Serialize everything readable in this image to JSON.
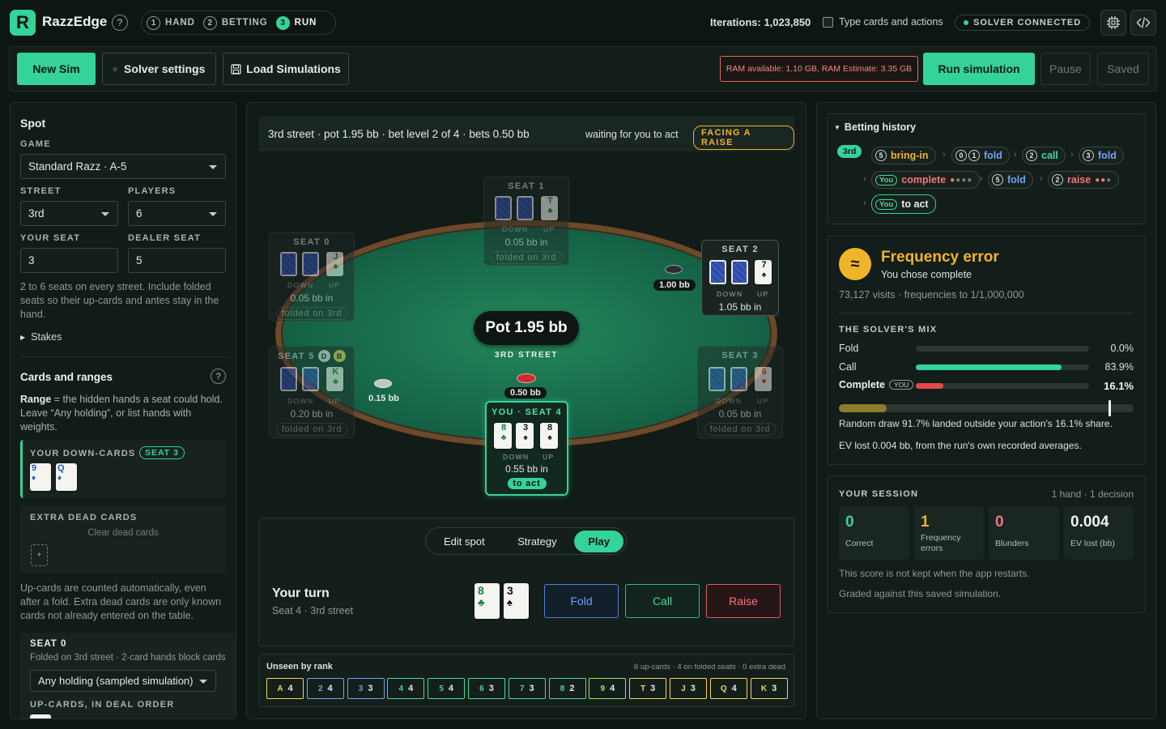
{
  "app": {
    "name": "RazzEdge",
    "help": "?"
  },
  "steps": [
    {
      "n": "1",
      "label": "HAND"
    },
    {
      "n": "2",
      "label": "BETTING"
    },
    {
      "n": "3",
      "label": "RUN"
    }
  ],
  "header": {
    "iterations": "Iterations: 1,023,850",
    "type_cards_label": "Type cards and actions",
    "solver_status": "SOLVER CONNECTED"
  },
  "toolbar": {
    "new_sim": "New Sim",
    "solver_settings": "Solver settings",
    "load_simulations": "Load Simulations",
    "ram_warning": "RAM available: 1.10 GB, RAM Estimate: 3.35 GB",
    "run_simulation": "Run simulation",
    "pause": "Pause",
    "saved": "Saved"
  },
  "left": {
    "spot_title": "Spot",
    "game_label": "GAME",
    "game_value": "Standard Razz · A-5",
    "street_label": "STREET",
    "street_value": "3rd",
    "players_label": "PLAYERS",
    "players_value": "6",
    "your_seat_label": "YOUR SEAT",
    "your_seat_value": "3",
    "dealer_seat_label": "DEALER SEAT",
    "dealer_seat_value": "5",
    "seats_help": "2 to 6 seats on every street. Include folded seats so their up-cards and antes stay in the hand.",
    "stakes": "Stakes",
    "cards_title": "Cards and ranges",
    "cards_help": "?",
    "range_word": "Range",
    "range_help": " = the hidden hands a seat could hold. Leave “Any holding”, or list hands with weights.",
    "your_down_cards": "YOUR DOWN-CARDS",
    "seat_tag": "SEAT 3",
    "down_cards": [
      {
        "rank": "9",
        "suit": "♦"
      },
      {
        "rank": "Q",
        "suit": "♦"
      }
    ],
    "extra_dead": "EXTRA DEAD CARDS",
    "clear_dead": "Clear dead cards",
    "add": "+",
    "upcards_help": "Up-cards are counted automatically, even after a fold. Extra dead cards are only known cards not already entered on the table.",
    "seat0_title": "SEAT 0",
    "seat0_sub": "Folded on 3rd street · 2-card hands block cards",
    "seat0_holding": "Any holding (sampled simulation)",
    "upcards_order": "UP-CARDS, IN DEAL ORDER"
  },
  "center": {
    "street_info": "3rd street · pot 1.95 bb · bet level 2 of 4 · bets 0.50 bb",
    "waiting": "waiting for you to act",
    "facing": "FACING A RAISE",
    "pot": "Pot 1.95 bb",
    "street_name": "3RD STREET",
    "down": "DOWN",
    "up": "UP",
    "seats": [
      {
        "name": "SEAT 0",
        "upcard": {
          "rank": "J",
          "suit": "♣"
        },
        "in": "0.05 bb in",
        "status": "folded on 3rd"
      },
      {
        "name": "SEAT 1",
        "upcard": {
          "rank": "T",
          "suit": "♣"
        },
        "in": "0.05 bb in",
        "status": "folded on 3rd"
      },
      {
        "name": "SEAT 2",
        "upcard": {
          "rank": "7",
          "suit": "♠"
        },
        "in": "1.05 bb in",
        "status": ""
      },
      {
        "name": "SEAT 3",
        "upcard": {
          "rank": "6",
          "suit": "♥"
        },
        "in": "0.05 bb in",
        "status": "folded on 3rd"
      },
      {
        "name": "YOU · SEAT 4",
        "cards": [
          {
            "rank": "8",
            "suit": "♣"
          },
          {
            "rank": "3",
            "suit": "♠"
          },
          {
            "rank": "8",
            "suit": "♠"
          }
        ],
        "in": "0.55 bb in",
        "status": "to act"
      },
      {
        "name": "SEAT 5",
        "badges": [
          "D",
          "B"
        ],
        "upcard": {
          "rank": "K",
          "suit": "♣"
        },
        "in": "0.20 bb in",
        "status": "folded on 3rd"
      }
    ],
    "bets": {
      "seat2": "1.00 bb",
      "seat4": "0.50 bb",
      "seat5": "0.15 bb"
    },
    "modes": [
      "Edit spot",
      "Strategy",
      "Play"
    ],
    "your_turn": "Your turn",
    "turn_sub": "Seat 4 · 3rd street",
    "hole": [
      {
        "rank": "8",
        "suit": "♣"
      },
      {
        "rank": "3",
        "suit": "♠"
      }
    ],
    "actions": {
      "fold": "Fold",
      "call": "Call",
      "raise": "Raise"
    },
    "unseen_title": "Unseen by rank",
    "unseen_meta": "6 up-cards · 4 on folded seats · 0 extra dead",
    "unseen": [
      {
        "rank": "A",
        "count": "4"
      },
      {
        "rank": "2",
        "count": "4"
      },
      {
        "rank": "3",
        "count": "3"
      },
      {
        "rank": "4",
        "count": "4"
      },
      {
        "rank": "5",
        "count": "4"
      },
      {
        "rank": "6",
        "count": "3"
      },
      {
        "rank": "7",
        "count": "3"
      },
      {
        "rank": "8",
        "count": "2"
      },
      {
        "rank": "9",
        "count": "4"
      },
      {
        "rank": "T",
        "count": "3"
      },
      {
        "rank": "J",
        "count": "3"
      },
      {
        "rank": "Q",
        "count": "4"
      },
      {
        "rank": "K",
        "count": "3"
      }
    ]
  },
  "history": {
    "title": "Betting history",
    "street_tag": "3rd",
    "actions": [
      {
        "seat": "5",
        "text": "bring-in"
      },
      {
        "seat": "0",
        "seat2": "1",
        "text": "fold"
      },
      {
        "seat": "2",
        "text": "call"
      },
      {
        "seat": "3",
        "text": "fold"
      },
      {
        "seat": "You",
        "text": "complete"
      },
      {
        "seat": "5",
        "text": "fold"
      },
      {
        "seat": "2",
        "text": "raise"
      },
      {
        "seat": "You",
        "text": "to act"
      }
    ]
  },
  "feedback": {
    "icon": "≈",
    "title": "Frequency error",
    "chose": "You chose complete",
    "visits": "73,127 visits · frequencies to 1/1,000,000",
    "mix_title": "THE SOLVER'S MIX",
    "mix": [
      {
        "label": "Fold",
        "pct": "0.0%",
        "value": 0.0
      },
      {
        "label": "Call",
        "pct": "83.9%",
        "value": 83.9
      },
      {
        "label": "Complete",
        "pct": "16.1%",
        "value": 16.1,
        "tag": "YOU"
      }
    ],
    "draw_value": 91.7,
    "draw_text": "Random draw 91.7% landed outside your action's 16.1% share.",
    "ev_text": "EV lost 0.004 bb, from the run's own recorded averages."
  },
  "session": {
    "title": "YOUR SESSION",
    "meta": "1 hand · 1 decision",
    "stats": [
      {
        "value": "0",
        "label": "Correct"
      },
      {
        "value": "1",
        "label": "Frequency errors"
      },
      {
        "value": "0",
        "label": "Blunders"
      },
      {
        "value": "0.004",
        "label": "EV lost (bb)"
      }
    ],
    "note1": "This score is not kept when the app restarts.",
    "note2": "Graded against this saved simulation."
  },
  "colors": {
    "accent": "#34d399",
    "error": "#e26a5c",
    "warn": "#f0b429"
  }
}
